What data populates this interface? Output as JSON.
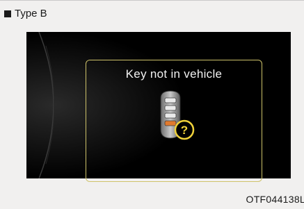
{
  "section": {
    "label": "Type B"
  },
  "display": {
    "message": "Key not in vehicle",
    "icon": "smart-key-question-icon"
  },
  "footer": {
    "code": "OTF044138L"
  },
  "colors": {
    "frame_border": "#cfc36a",
    "badge": "#f0d23a",
    "screen_bg": "#000000"
  }
}
